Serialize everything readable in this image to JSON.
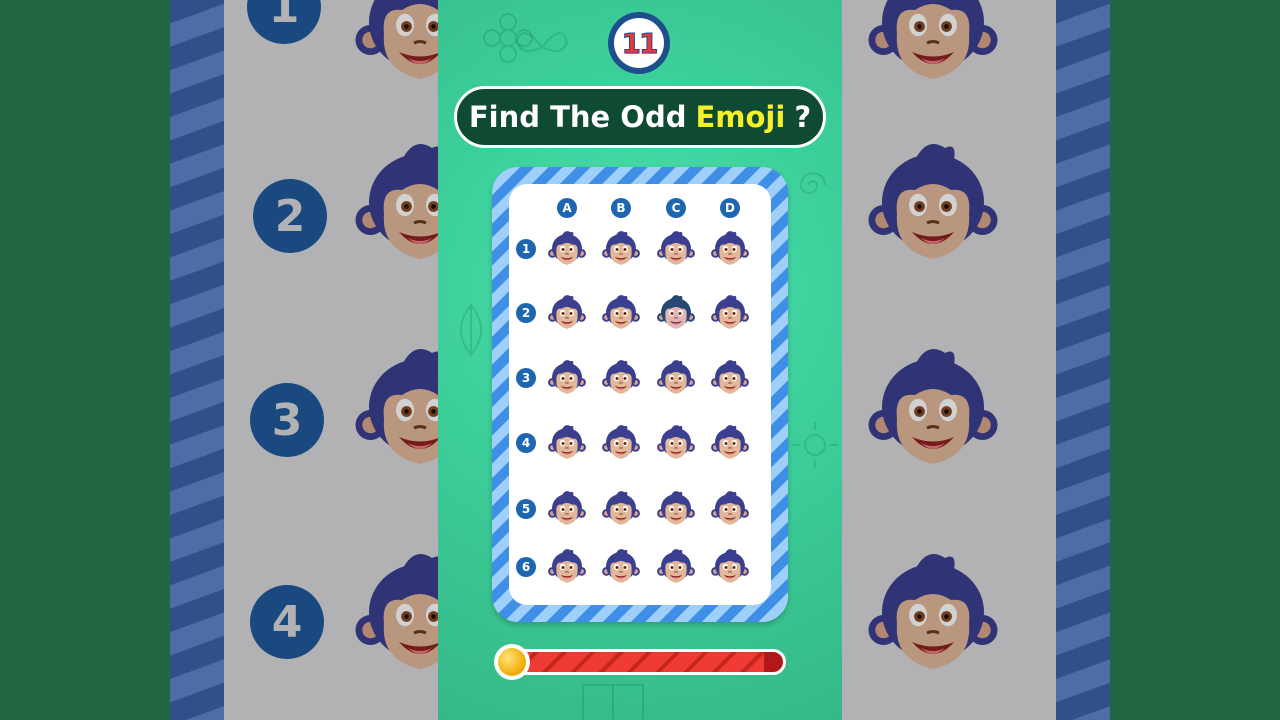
{
  "level": {
    "number": "11"
  },
  "title": {
    "prefix": "Find The Odd",
    "highlight": "Emoji",
    "suffix": "?"
  },
  "grid": {
    "columns": [
      "A",
      "B",
      "C",
      "D"
    ],
    "rows": [
      "1",
      "2",
      "3",
      "4",
      "5",
      "6"
    ],
    "emoji_icon": "monkey-face-icon",
    "odd_cell": {
      "row": "2",
      "column": "C",
      "icon": "darker-monkey-face-icon"
    }
  },
  "background": {
    "numbers": [
      "1",
      "2",
      "3",
      "4"
    ]
  },
  "timer": {
    "remaining_fraction": 0.93,
    "icon": "clock-coin-icon"
  },
  "colors": {
    "panel": "#3ccf9a",
    "title_bg": "#0f4a32",
    "title_highlight": "#f6f02a",
    "label_blue": "#1f66b0",
    "timer_red": "#ee3b33"
  }
}
